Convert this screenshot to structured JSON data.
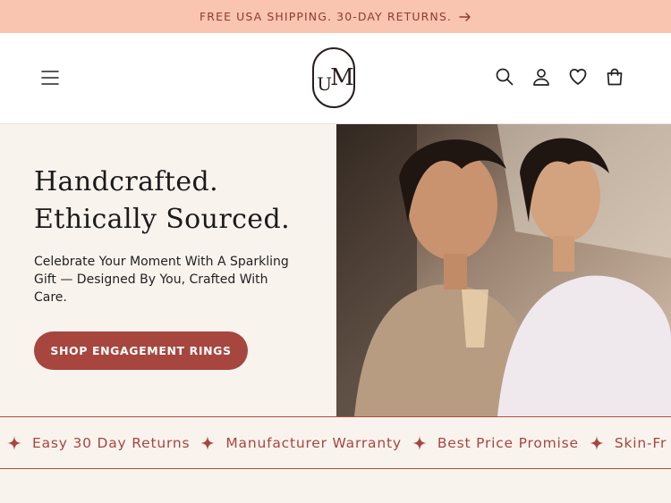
{
  "announcement": {
    "text": "FREE USA SHIPPING. 30-DAY RETURNS."
  },
  "header": {
    "logo_letters": {
      "u": "U",
      "m": "M"
    },
    "icons": [
      "menu-icon",
      "search-icon",
      "account-icon",
      "wishlist-heart-icon",
      "cart-icon"
    ]
  },
  "hero": {
    "title_line1": "Handcrafted.",
    "title_line2": "Ethically Sourced.",
    "subtitle": "Celebrate Your Moment With A Sparkling Gift — Designed By You, Crafted With Care.",
    "cta_label": "SHOP ENGAGEMENT RINGS"
  },
  "ticker": {
    "items": [
      "Easy 30 Day Returns",
      "Manufacturer Warranty",
      "Best Price Promise",
      "Skin-Fr"
    ]
  },
  "colors": {
    "announcement_bg": "#f9c5b1",
    "accent": "#a6463f",
    "page_bg": "#f9f3ee"
  }
}
